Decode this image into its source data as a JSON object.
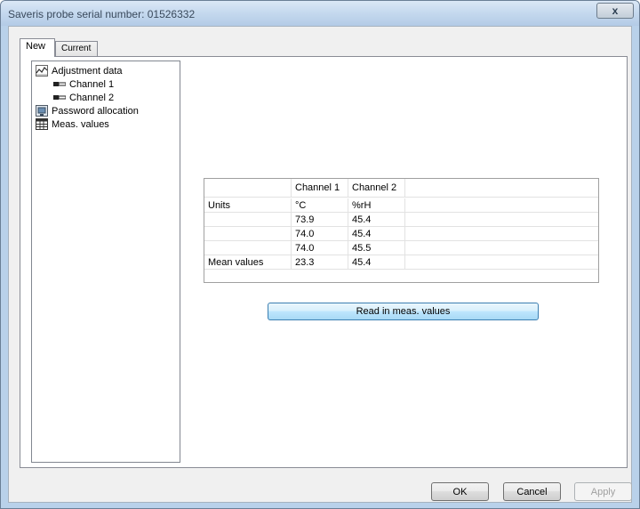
{
  "window": {
    "title": "Saveris probe serial number:  01526332",
    "close_label": "x"
  },
  "tabs": [
    {
      "label": "New",
      "active": true
    },
    {
      "label": "Current",
      "active": false
    }
  ],
  "tree": {
    "items": [
      {
        "label": "Adjustment data",
        "icon": "chart-icon",
        "level": 0
      },
      {
        "label": "Channel 1",
        "icon": "probe-icon",
        "level": 1
      },
      {
        "label": "Channel 2",
        "icon": "probe-icon",
        "level": 1
      },
      {
        "label": "Password allocation",
        "icon": "lock-icon",
        "level": 0
      },
      {
        "label": "Meas. values",
        "icon": "table-icon",
        "level": 0
      }
    ]
  },
  "meas_table": {
    "headers": [
      "",
      "Channel 1",
      "Channel 2",
      ""
    ],
    "rows": [
      [
        "Units",
        "°C",
        "%rH"
      ],
      [
        "",
        "73.9",
        "45.4"
      ],
      [
        "",
        "74.0",
        "45.4"
      ],
      [
        "",
        "74.0",
        "45.5"
      ],
      [
        "Mean values",
        "23.3",
        "45.4"
      ]
    ]
  },
  "read_button": {
    "label": "Read in meas. values"
  },
  "footer": {
    "ok_label": "OK",
    "cancel_label": "Cancel",
    "apply_label": "Apply"
  }
}
